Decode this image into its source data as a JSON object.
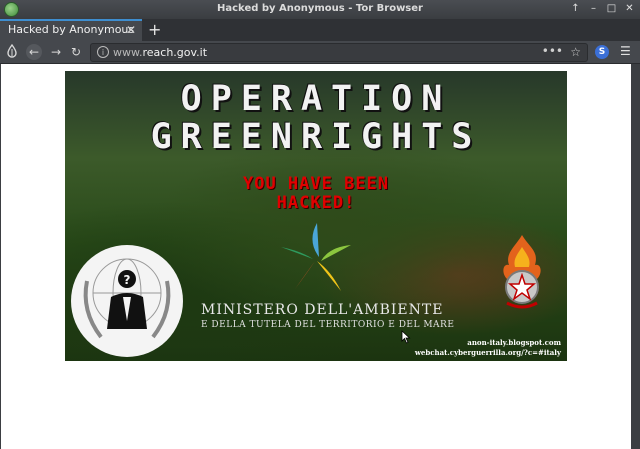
{
  "window": {
    "title": "Hacked by Anonymous - Tor Browser",
    "controls": [
      "↑",
      "–",
      "□",
      "✕"
    ]
  },
  "tabs": [
    {
      "label": "Hacked by Anonymous",
      "active": true
    }
  ],
  "toolbar": {
    "url_prefix": "www.",
    "url_domain": "reach.gov.it",
    "ext_letter": "S"
  },
  "banner": {
    "title_line1": "OPERATION",
    "title_line2": "GREENRIGHTS",
    "hacked_line1": "YOU HAVE BEEN",
    "hacked_line2": "HACKED!",
    "ministry_line1": "MINISTERO DELL'AMBIENTE",
    "ministry_line2": "E DELLA TUTELA DEL TERRITORIO E DEL MARE",
    "blog": "anon-italy.blogspot.com",
    "chat": "webchat.cyberguerrilla.org/?c=#italy"
  },
  "colors": {
    "accent_tab": "#3e8ed0",
    "hacked_text": "#e00000"
  },
  "icons": [
    "app-icon",
    "home-icon",
    "back-icon",
    "forward-icon",
    "reload-icon",
    "info-icon",
    "page-actions-icon",
    "bookmark-star-icon",
    "extension-icon",
    "menu-icon"
  ]
}
